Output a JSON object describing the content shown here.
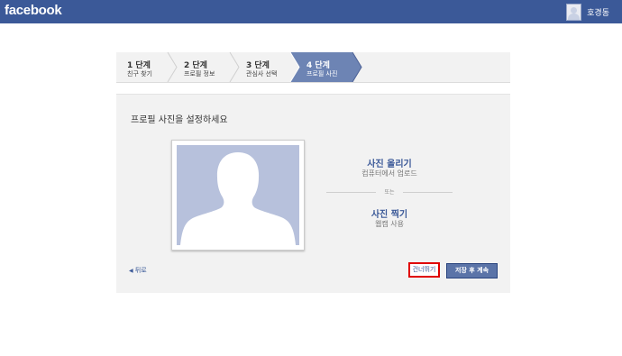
{
  "header": {
    "logo": "facebook",
    "user_name": "호경동"
  },
  "steps": [
    {
      "number": "1 단계",
      "label": "친구 찾기",
      "active": false
    },
    {
      "number": "2 단계",
      "label": "프로필 정보",
      "active": false
    },
    {
      "number": "3 단계",
      "label": "관심사 선택",
      "active": false
    },
    {
      "number": "4 단계",
      "label": "프로필 사진",
      "active": true
    }
  ],
  "panel": {
    "title": "프로필 사진을 설정하세요",
    "upload_title": "사진 올리기",
    "upload_sub": "컴퓨터에서 업로드",
    "or_text": "또는",
    "webcam_title": "사진 찍기",
    "webcam_sub": "웹캠 사용",
    "back_link": "뒤로",
    "skip_button": "건너뛰기",
    "save_button": "저장 후 계속"
  },
  "colors": {
    "brand": "#3b5998",
    "active_step": "#6d84b4",
    "silhouette_bg": "#b7c1dc",
    "highlight_box": "#e00000"
  }
}
